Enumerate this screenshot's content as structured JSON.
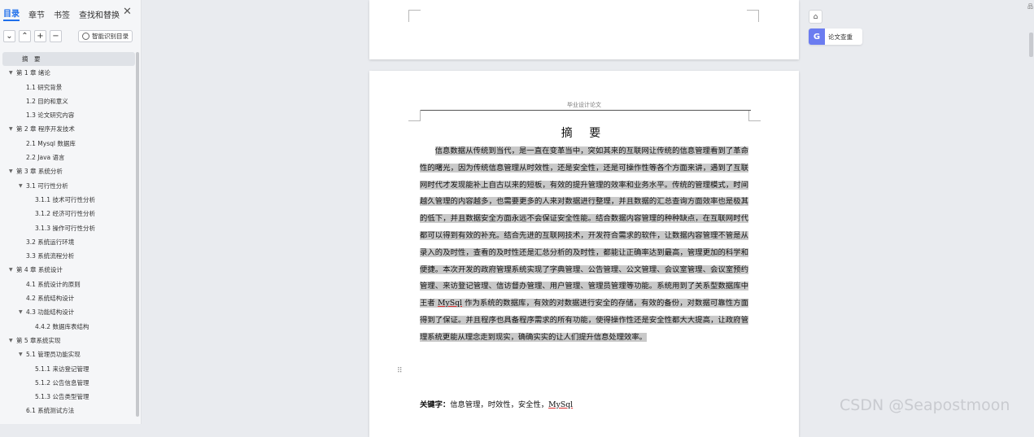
{
  "nav": {
    "tabs": [
      "目录",
      "章节",
      "书签",
      "查找和替换"
    ],
    "close": "✕",
    "tools": [
      "⌄",
      "⌃",
      "+",
      "−"
    ],
    "smart_button": "智能识别目录",
    "toc": [
      {
        "label": "摘　要",
        "level": 1,
        "arrow": "",
        "selected": true
      },
      {
        "label": "第 1 章 绪论",
        "level": 0,
        "arrow": "▼"
      },
      {
        "label": "1.1 研究背景",
        "level": 2,
        "arrow": ""
      },
      {
        "label": "1.2 目的和意义",
        "level": 2,
        "arrow": ""
      },
      {
        "label": "1.3 论文研究内容",
        "level": 2,
        "arrow": ""
      },
      {
        "label": "第 2 章 程序开发技术",
        "level": 0,
        "arrow": "▼"
      },
      {
        "label": "2.1 Mysql 数据库",
        "level": 2,
        "arrow": ""
      },
      {
        "label": "2.2 Java 语言",
        "level": 2,
        "arrow": ""
      },
      {
        "label": "第 3 章 系统分析",
        "level": 0,
        "arrow": "▼"
      },
      {
        "label": "3.1 可行性分析",
        "level": 1,
        "arrow": "▼"
      },
      {
        "label": "3.1.1 技术可行性分析",
        "level": 3,
        "arrow": ""
      },
      {
        "label": "3.1.2 经济可行性分析",
        "level": 3,
        "arrow": ""
      },
      {
        "label": "3.1.3 操作可行性分析",
        "level": 3,
        "arrow": ""
      },
      {
        "label": "3.2 系统运行环境",
        "level": 2,
        "arrow": ""
      },
      {
        "label": "3.3 系统流程分析",
        "level": 2,
        "arrow": ""
      },
      {
        "label": "第 4 章 系统设计",
        "level": 0,
        "arrow": "▼"
      },
      {
        "label": "4.1 系统设计的原则",
        "level": 2,
        "arrow": ""
      },
      {
        "label": "4.2 系统结构设计",
        "level": 2,
        "arrow": ""
      },
      {
        "label": "4.3 功能结构设计",
        "level": 1,
        "arrow": "▼"
      },
      {
        "label": "4.4.2 数据库表结构",
        "level": 3,
        "arrow": ""
      },
      {
        "label": "第 5 章系统实现",
        "level": 0,
        "arrow": "▼"
      },
      {
        "label": "5.1 管理员功能实现",
        "level": 1,
        "arrow": "▼"
      },
      {
        "label": "5.1.1 来访登记管理",
        "level": 3,
        "arrow": ""
      },
      {
        "label": "5.1.2 公告信息管理",
        "level": 3,
        "arrow": ""
      },
      {
        "label": "5.1.3 公告类型管理",
        "level": 3,
        "arrow": ""
      },
      {
        "label": "6.1 系统测试方法",
        "level": 2,
        "arrow": ""
      }
    ]
  },
  "doc": {
    "header": "毕业设计论文",
    "title": "摘 要",
    "abstract_parts": [
      "信息数据从传统到当代，是一直在变革当中，突如其来的互联网让传统的信息管理看到了革命性的曙光，因为传统信息管理从时效性，还是安全性，还是可操作性等各个方面来讲，遇到了互联网时代才发现能补上自古以来的短板，有效的提升管理的效率和业务水平。传统的管理模式，时间越久管理的内容越多，也需要更多的人来对数据进行整理，并且数据的汇总查询方面效率也是极其的低下，并且数据安全方面永远不会保证安全性能。结合数据内容管理的种种缺点，在互联网时代都可以得到有效的补充。结合先进的互联网技术，开发符合需求的软件，让数据内容管理不管是从录入的及时性，查看的及时性还是汇总分析的及时性，都能让正确率达到最高，管理更加的科学和便捷。本次开发的政府管理系统实现了字典管理、公告管理、公文管理、会议室管理、会议室预约管理、来访登记管理、信访督办管理、用户管理、管理员管理等功能。系统用到了关系型数据库中王者 ",
      "MySql",
      " 作为系统的数据库，有效的对数据进行安全的存储，有效的备份，对数据可靠性方面得到了保证。并且程序也具备程序需求的所有功能，使得操作性还是安全性都大大提高，让政府管理系统更能从理念走到现实，确确实实的让人们提升信息处理效率。"
    ],
    "keywords_label": "关键字：",
    "keywords_text": "信息管理，时效性，安全性，",
    "keywords_u": "MySql",
    "drag_handle": "⠿"
  },
  "right": {
    "home": "⌂",
    "check_icon": "G",
    "check_label": "论文查重",
    "top_mark": "品"
  },
  "watermark": "CSDN @Seapostmoon",
  "colors": {
    "accent": "#1f6feb",
    "check": "#6b7cf0",
    "highlight": "#c9c9c9"
  }
}
